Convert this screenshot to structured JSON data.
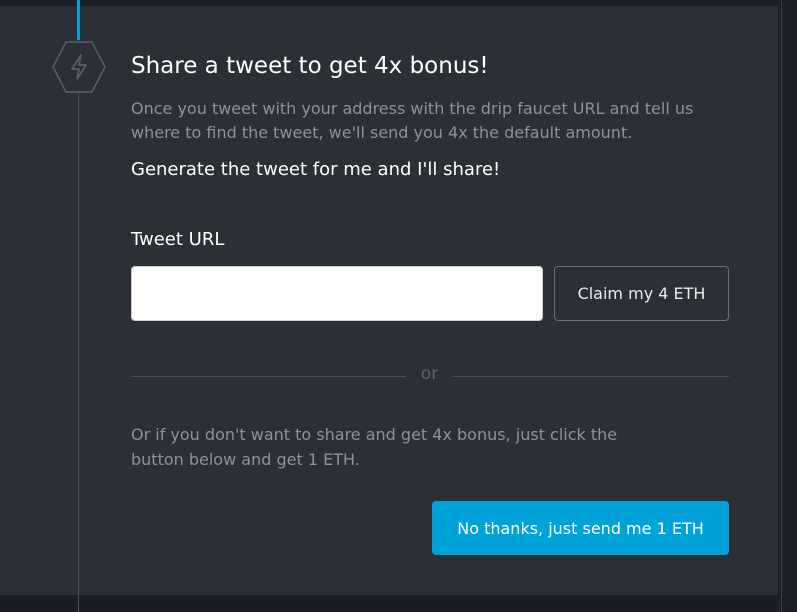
{
  "step": {
    "icon": "lightning-bolt-icon",
    "title": "Share a tweet to get 4x bonus!",
    "description": "Once you tweet with your address with the drip faucet URL and tell us where to find the tweet, we'll send you 4x the default amount.",
    "generate_link": "Generate the tweet for me and I'll share!"
  },
  "tweet_form": {
    "label": "Tweet URL",
    "input_value": "",
    "claim_button": "Claim my 4 ETH"
  },
  "divider": {
    "text": "or"
  },
  "alternative": {
    "description": "Or if you don't want to share and get 4x bonus, just click the button below and get 1 ETH.",
    "button": "No thanks, just send me 1 ETH"
  },
  "colors": {
    "panel_background": "#2b2f36",
    "page_background": "#1b1e24",
    "accent": "#00a3d9",
    "muted_text": "#8d939b",
    "primary_text": "#ffffff"
  }
}
